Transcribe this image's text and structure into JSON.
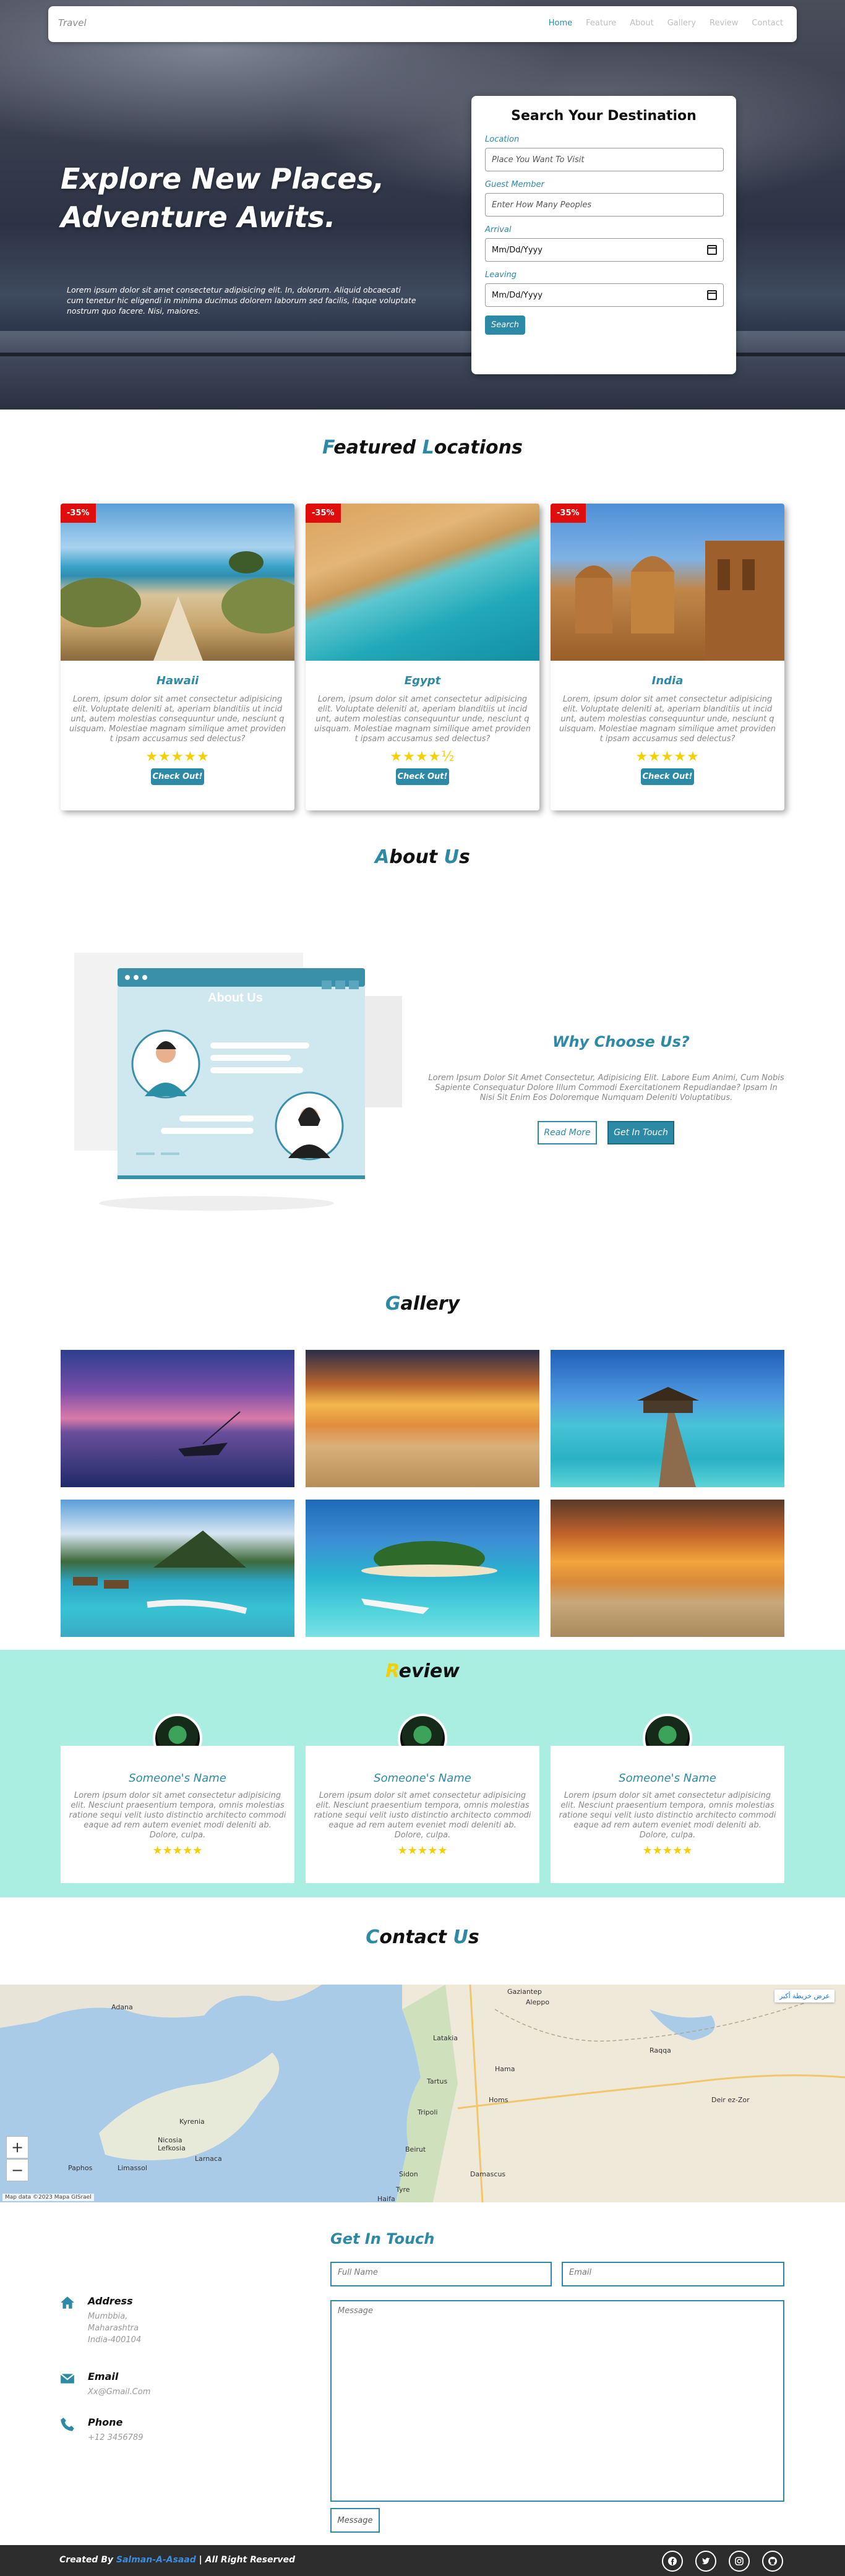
{
  "nav": {
    "brand": "Travel",
    "links": [
      "Home",
      "Feature",
      "About",
      "Gallery",
      "Review",
      "Contact"
    ],
    "active": "Home"
  },
  "hero": {
    "title_line1": "Explore New Places,",
    "title_line2": "Adventure Awits.",
    "text": "Lorem ipsum dolor sit amet consectetur adipisicing elit. In, dolorum. Aliquid obcaecati cum tenetur hic eligendi in minima ducimus dolorem laborum sed facilis, itaque voluptate nostrum quo facere. Nisi, maiores."
  },
  "search": {
    "title": "Search Your Destination",
    "location_label": "Location",
    "location_placeholder": "Place You Want To Visit",
    "guest_label": "Guest Member",
    "guest_placeholder": "Enter How Many Peoples",
    "arrival_label": "Arrival",
    "arrival_value": "Mm/Dd/Yyyy",
    "leaving_label": "Leaving",
    "leaving_value": "Mm/Dd/Yyyy",
    "button": "Search"
  },
  "featured": {
    "title_first": "F",
    "title_rest": "eatured",
    "title_first2": "L",
    "title_rest2": "ocations",
    "cards": [
      {
        "badge": "-35%",
        "name": "Hawaii",
        "desc": "Lorem, ipsum dolor sit amet consectetur adipisicing elit. Voluptate deleniti at, aperiam blanditiis ut incid unt, autem molestias consequuntur unde, nesciunt q uisquam. Molestiae magnam similique amet providen t ipsam accusamus sed delectus?",
        "stars": "★★★★★",
        "button": "Check Out!"
      },
      {
        "badge": "-35%",
        "name": "Egypt",
        "desc": "Lorem, ipsum dolor sit amet consectetur adipisicing elit. Voluptate deleniti at, aperiam blanditiis ut incid unt, autem molestias consequuntur unde, nesciunt q uisquam. Molestiae magnam similique amet providen t ipsam accusamus sed delectus?",
        "stars": "★★★★½",
        "button": "Check Out!"
      },
      {
        "badge": "-35%",
        "name": "India",
        "desc": "Lorem, ipsum dolor sit amet consectetur adipisicing elit. Voluptate deleniti at, aperiam blanditiis ut incid unt, autem molestias consequuntur unde, nesciunt q uisquam. Molestiae magnam similique amet providen t ipsam accusamus sed delectus?",
        "stars": "★★★★★",
        "button": "Check Out!"
      }
    ]
  },
  "about": {
    "title_first": "A",
    "title_rest": "bout",
    "title_first2": "U",
    "title_rest2": "s",
    "illustration_label": "About Us",
    "why_title": "Why Choose Us?",
    "why_text": "Lorem Ipsum Dolor Sit Amet Consectetur, Adipisicing Elit. Labore Eum Animi, Cum Nobis Sapiente Consequatur Dolore Illum Commodi Exercitationem Repudiandae? Ipsam In Nisi Sit Enim Eos Doloremque Numquam Deleniti Voluptatibus.",
    "read_more": "Read More",
    "get_in_touch": "Get In Touch"
  },
  "gallery": {
    "title_first": "G",
    "title_rest": "allery"
  },
  "review": {
    "title_first": "R",
    "title_rest": "eview",
    "cards": [
      {
        "name": "Someone's Name",
        "text": "Lorem ipsum dolor sit amet consectetur adipisicing elit. Nesciunt praesentium tempora, omnis molestias ratione sequi velit iusto distinctio architecto commodi eaque ad rem autem eveniet modi deleniti ab. Dolore, culpa.",
        "stars": "★★★★★"
      },
      {
        "name": "Someone's Name",
        "text": "Lorem ipsum dolor sit amet consectetur adipisicing elit. Nesciunt praesentium tempora, omnis molestias ratione sequi velit iusto distinctio architecto commodi eaque ad rem autem eveniet modi deleniti ab. Dolore, culpa.",
        "stars": "★★★★★"
      },
      {
        "name": "Someone's Name",
        "text": "Lorem ipsum dolor sit amet consectetur adipisicing elit. Nesciunt praesentium tempora, omnis molestias ratione sequi velit iusto distinctio architecto commodi eaque ad rem autem eveniet modi deleniti ab. Dolore, culpa.",
        "stars": "★★★★★"
      }
    ]
  },
  "contact": {
    "title_first": "C",
    "title_rest": "ontact",
    "title_first2": "U",
    "title_rest2": "s",
    "map_labels": [
      "Nicosia",
      "Lefkosia",
      "Latakia",
      "Tartus",
      "Tripoli",
      "Beirut",
      "Homs",
      "Hama",
      "Aleppo",
      "Raqqa",
      "Sidon",
      "Tyre",
      "Haifa",
      "Damascus",
      "Limassol",
      "Larnaca",
      "Paphos",
      "Kyrenia",
      "Deir ez-Zor",
      "Gaziantep",
      "Adana"
    ],
    "map_button": "عرض خريطة أكبر",
    "map_attribution": "Map data ©2023 Mapa GISrael",
    "zoom_in": "+",
    "zoom_out": "−",
    "form_title": "Get In Touch",
    "full_name_placeholder": "Full Name",
    "email_placeholder": "Email",
    "message_placeholder": "Message",
    "submit": "Message",
    "address_heading": "Address",
    "address_lines": [
      "Mumbbia,",
      "Maharashtra",
      "India-400104"
    ],
    "email_heading": "Email",
    "email_value": "Xx@Gmail.Com",
    "phone_heading": "Phone",
    "phone_value": "+12 3456789"
  },
  "footer": {
    "created_by": "Created By",
    "author": "Salman-A-Asaad",
    "rights": "| All Right Reserved"
  },
  "colors": {
    "accent": "#2c8aa7",
    "badge": "#e00d0d",
    "review_bg": "#aaeee2",
    "star": "#f5d000",
    "footer": "#2d2d2d"
  }
}
